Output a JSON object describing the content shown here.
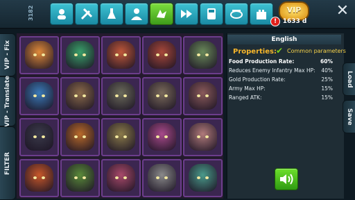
{
  "top": {
    "counter": "3182",
    "buttons": [
      "heroes-icon",
      "tools-icon",
      "potion-icon",
      "profile-icon",
      "dragon-icon",
      "fast-forward-icon",
      "calculator-icon",
      "arena-icon",
      "castle-icon"
    ],
    "active_index": 4,
    "vip_label": "VIP",
    "vip_days": "1633 d",
    "alert": "!",
    "close": "✕"
  },
  "left_tabs": {
    "vip_fix": "VIP - Fix",
    "vip_translate": "VIP - Translate",
    "filter": "FILTER",
    "plus": "+"
  },
  "panel": {
    "language": "English",
    "properties_label": "Properties:",
    "common_label": "Common parameters",
    "rows": [
      {
        "name": "Food Production Rate:",
        "value": "60%"
      },
      {
        "name": "Reduces Enemy Infantry Max HP:",
        "value": "40%"
      },
      {
        "name": "Gold Production Rate:",
        "value": "25%"
      },
      {
        "name": "Army Max HP:",
        "value": "15%"
      },
      {
        "name": "Ranged ATK:",
        "value": "15%"
      }
    ]
  },
  "right_tabs": {
    "load": "Load",
    "save": "Save"
  },
  "sound_icon": "speaker-icon",
  "colors": {
    "accent": "#3ec3d4",
    "active": "#7cde3e",
    "slot_border": "#6c3d8c",
    "orange": "#f6b52a"
  }
}
